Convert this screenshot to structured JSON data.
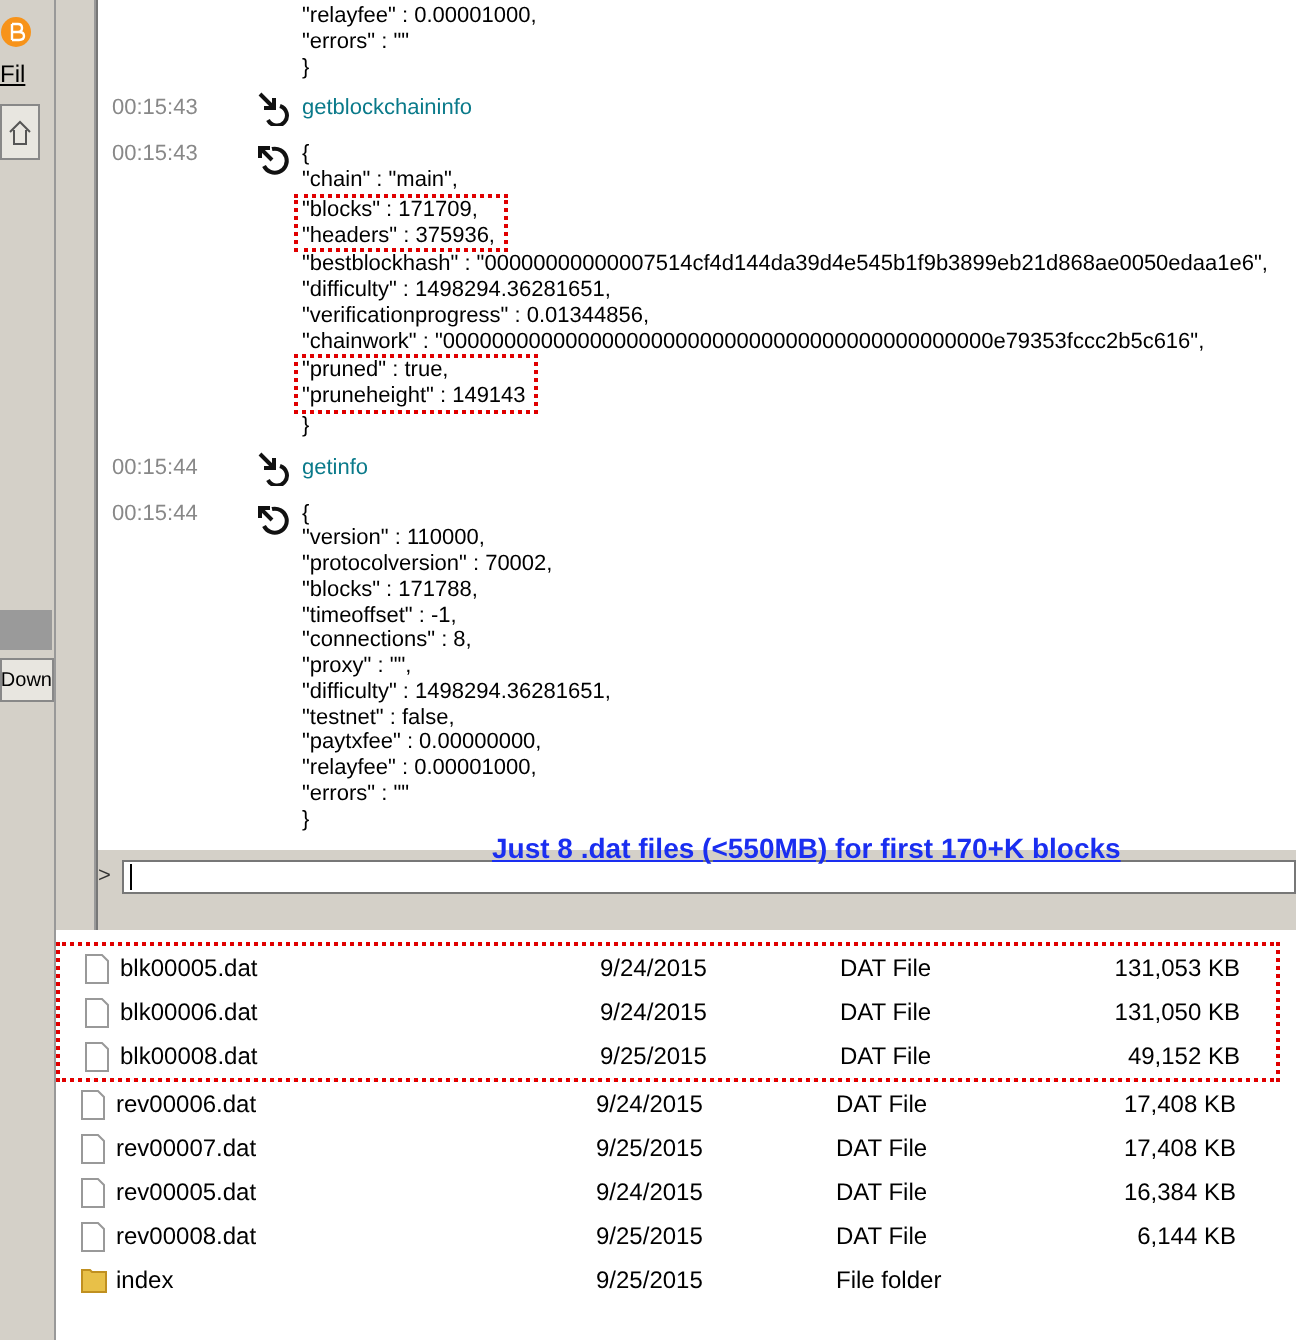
{
  "left_strip": {
    "menu_label": "Fil",
    "button_label": "Down"
  },
  "console": {
    "entries": [
      {
        "kind": "reply",
        "lines": [
          {
            "text": "\"relayfee\" : 0.00001000,",
            "highlighted": false
          },
          {
            "text": "\"errors\" : \"\"",
            "highlighted": false
          },
          {
            "text": "}",
            "highlighted": false
          }
        ]
      },
      {
        "kind": "command",
        "time": "00:15:43",
        "lines": [
          {
            "text": "getblockchaininfo",
            "highlighted": false
          }
        ]
      },
      {
        "kind": "reply",
        "time": "00:15:43",
        "lines": [
          {
            "text": "{",
            "highlighted": false
          },
          {
            "text": "\"chain\" : \"main\",",
            "highlighted": false
          },
          {
            "text": "\"blocks\" : 171709,",
            "highlighted": true
          },
          {
            "text": "\"headers\" : 375936,",
            "highlighted": true
          },
          {
            "text": "\"bestblockhash\" : \"00000000000007514cf4d144da39d4e545b1f9b3899eb21d868ae0050edaa1e6\",",
            "highlighted": false
          },
          {
            "text": "\"difficulty\" : 1498294.36281651,",
            "highlighted": false
          },
          {
            "text": "\"verificationprogress\" : 0.01344856,",
            "highlighted": false
          },
          {
            "text": "\"chainwork\" : \"000000000000000000000000000000000000000000000e79353fccc2b5c616\",",
            "highlighted": false
          },
          {
            "text": "\"pruned\" : true,",
            "highlighted": true
          },
          {
            "text": "\"pruneheight\" : 149143",
            "highlighted": true
          },
          {
            "text": "}",
            "highlighted": false
          }
        ]
      },
      {
        "kind": "command",
        "time": "00:15:44",
        "lines": [
          {
            "text": "getinfo",
            "highlighted": false
          }
        ]
      },
      {
        "kind": "reply",
        "time": "00:15:44",
        "lines": [
          {
            "text": "{",
            "highlighted": false
          },
          {
            "text": "\"version\" : 110000,",
            "highlighted": false
          },
          {
            "text": "\"protocolversion\" : 70002,",
            "highlighted": false
          },
          {
            "text": "\"blocks\" : 171788,",
            "highlighted": false
          },
          {
            "text": "\"timeoffset\" : -1,",
            "highlighted": false
          },
          {
            "text": "\"connections\" : 8,",
            "highlighted": false
          },
          {
            "text": "\"proxy\" : \"\",",
            "highlighted": false
          },
          {
            "text": "\"difficulty\" : 1498294.36281651,",
            "highlighted": false
          },
          {
            "text": "\"testnet\" : false,",
            "highlighted": false
          },
          {
            "text": "\"paytxfee\" : 0.00000000,",
            "highlighted": false
          },
          {
            "text": "\"relayfee\" : 0.00001000,",
            "highlighted": false
          },
          {
            "text": "\"errors\" : \"\"",
            "highlighted": false
          },
          {
            "text": "}",
            "highlighted": false
          }
        ]
      }
    ],
    "prompt": ">"
  },
  "caption": "Just 8 .dat files (<550MB) for first 170+K blocks",
  "files": [
    {
      "kind": "file",
      "name": "blk00005.dat",
      "date": "9/24/2015",
      "type": "DAT File",
      "size": "131,053 KB",
      "highlighted": true
    },
    {
      "kind": "file",
      "name": "blk00006.dat",
      "date": "9/24/2015",
      "type": "DAT File",
      "size": "131,050 KB",
      "highlighted": true
    },
    {
      "kind": "file",
      "name": "blk00008.dat",
      "date": "9/25/2015",
      "type": "DAT File",
      "size": "49,152 KB",
      "highlighted": true
    },
    {
      "kind": "file",
      "name": "rev00006.dat",
      "date": "9/24/2015",
      "type": "DAT File",
      "size": "17,408 KB",
      "highlighted": false
    },
    {
      "kind": "file",
      "name": "rev00007.dat",
      "date": "9/25/2015",
      "type": "DAT File",
      "size": "17,408 KB",
      "highlighted": false
    },
    {
      "kind": "file",
      "name": "rev00005.dat",
      "date": "9/24/2015",
      "type": "DAT File",
      "size": "16,384 KB",
      "highlighted": false
    },
    {
      "kind": "file",
      "name": "rev00008.dat",
      "date": "9/25/2015",
      "type": "DAT File",
      "size": "6,144 KB",
      "highlighted": false
    },
    {
      "kind": "folder",
      "name": "index",
      "date": "9/25/2015",
      "type": "File folder",
      "highlighted": false
    }
  ]
}
